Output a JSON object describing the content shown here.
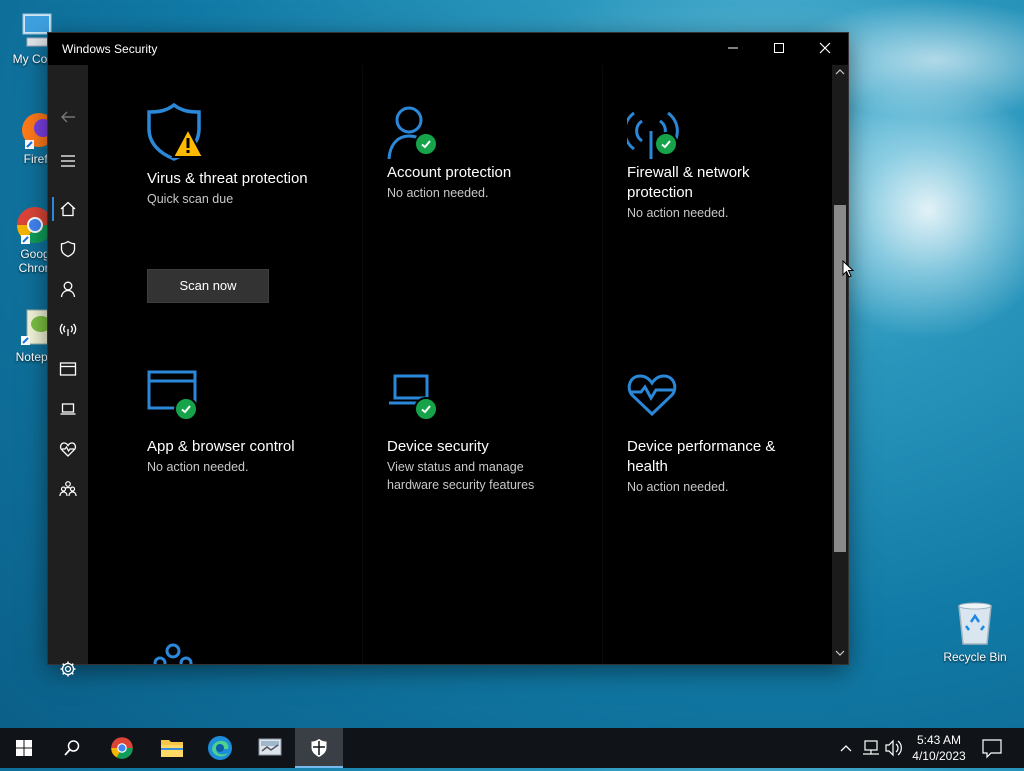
{
  "desktop": {
    "icons": [
      {
        "label": "My Com",
        "icon": "computer-icon"
      },
      {
        "label": "Firefo",
        "icon": "firefox-icon"
      },
      {
        "label": "Goog\nChron",
        "label_line1": "Goog",
        "label_line2": "Chron",
        "icon": "chrome-icon"
      },
      {
        "label": "Notepa",
        "icon": "notepad-icon"
      }
    ],
    "recycle_bin": {
      "label": "Recycle Bin",
      "icon": "recycle-bin-icon"
    }
  },
  "window": {
    "title": "Windows Security",
    "controls": {
      "minimize": "minimize-icon",
      "maximize": "maximize-icon",
      "close": "close-icon"
    }
  },
  "nav": {
    "back_icon": "back-arrow-icon",
    "menu_icon": "hamburger-menu-icon",
    "items": [
      {
        "name": "home",
        "icon": "home-icon",
        "selected": true
      },
      {
        "name": "virus-threat",
        "icon": "shield-icon"
      },
      {
        "name": "account",
        "icon": "person-icon"
      },
      {
        "name": "firewall",
        "icon": "antenna-icon"
      },
      {
        "name": "app-browser",
        "icon": "browser-window-icon"
      },
      {
        "name": "device-security",
        "icon": "laptop-icon"
      },
      {
        "name": "device-performance",
        "icon": "heart-pulse-icon"
      },
      {
        "name": "family",
        "icon": "family-icon"
      }
    ],
    "settings_icon": "gear-icon"
  },
  "cards": [
    {
      "title": "Virus & threat protection",
      "subtitle": "Quick scan due",
      "status": "warning",
      "button": "Scan now"
    },
    {
      "title": "Account protection",
      "subtitle": "No action needed.",
      "status": "ok"
    },
    {
      "title_line1": "Firewall & network",
      "title_line2": "protection",
      "subtitle": "No action needed.",
      "status": "ok"
    },
    {
      "title": "App & browser control",
      "subtitle": "No action needed.",
      "status": "ok"
    },
    {
      "title": "Device security",
      "subtitle_line1": "View status and manage",
      "subtitle_line2": "hardware security features",
      "status": "ok"
    },
    {
      "title_line1": "Device performance &",
      "title_line2": "health",
      "subtitle": "No action needed.",
      "status": "ok"
    }
  ],
  "taskbar": {
    "items": [
      {
        "name": "start",
        "icon": "windows-logo-icon"
      },
      {
        "name": "search",
        "icon": "search-icon"
      },
      {
        "name": "chrome",
        "icon": "chrome-icon"
      },
      {
        "name": "file-explorer",
        "icon": "folder-icon"
      },
      {
        "name": "edge",
        "icon": "edge-icon"
      },
      {
        "name": "app",
        "icon": "app-icon"
      },
      {
        "name": "windows-security",
        "icon": "shield-icon",
        "active": true
      }
    ],
    "tray": {
      "chevron": "chevron-up-icon",
      "network": "network-icon",
      "volume": "volume-icon",
      "notifications": "notification-icon"
    },
    "time": "5:43 AM",
    "date": "4/10/2023"
  },
  "colors": {
    "accent": "#2b88d8",
    "ok": "#16a34a",
    "warning": "#ffb900",
    "window_bg": "#000000",
    "nav_bg": "#1f1f1f"
  }
}
